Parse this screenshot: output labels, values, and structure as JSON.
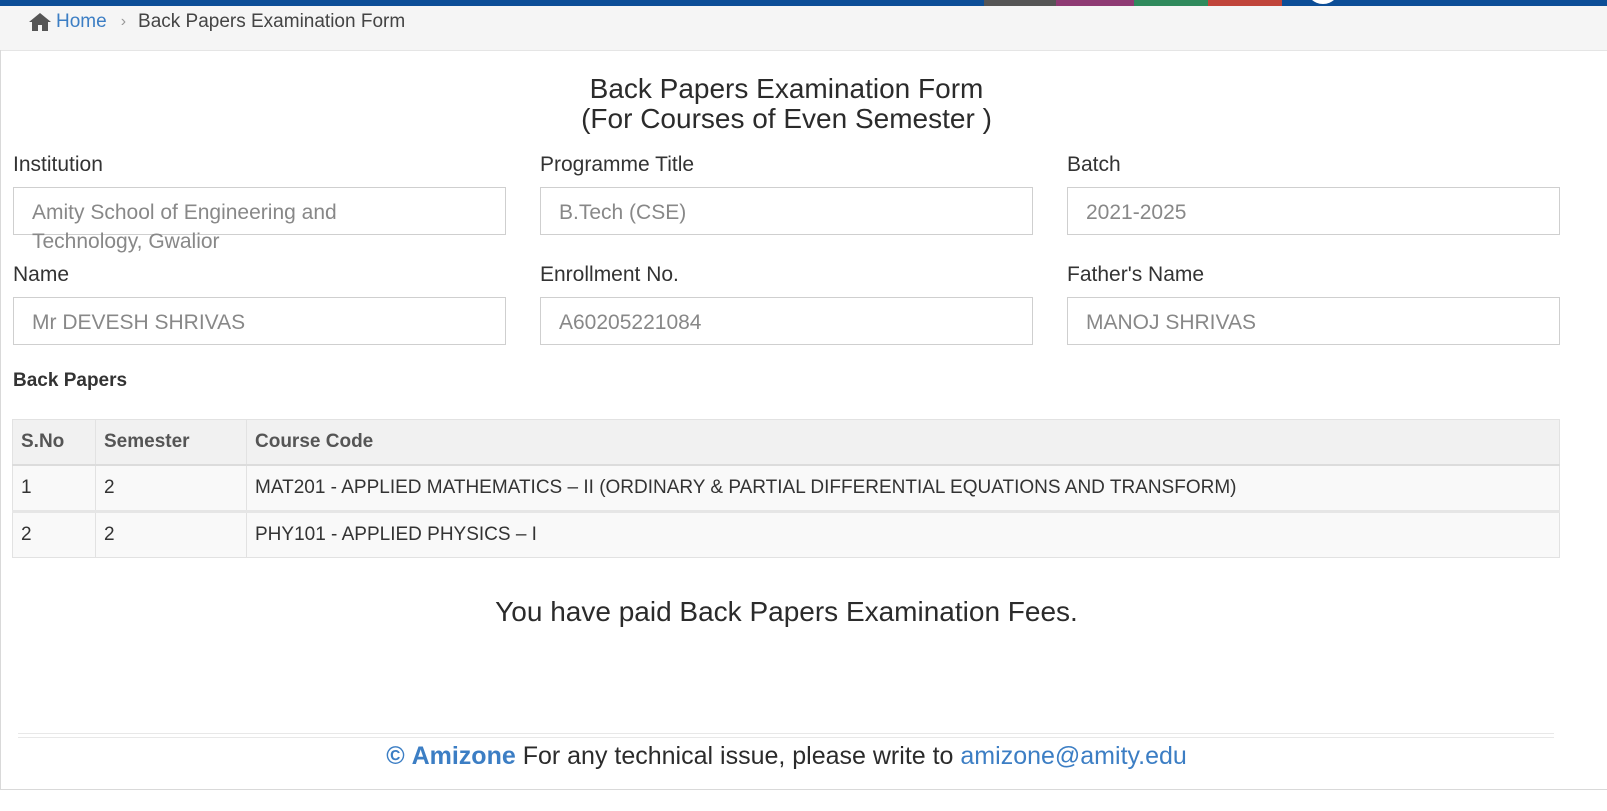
{
  "topbar": {
    "colors": [
      "#0c4e97",
      "#555555",
      "#8e3a73",
      "#2f8a5c",
      "#c0453a",
      "#0c4e97"
    ]
  },
  "breadcrumb": {
    "home_icon": "home-icon",
    "home_label": "Home",
    "separator_icon": "chevron-right-icon",
    "current": "Back Papers Examination Form"
  },
  "form": {
    "title_line1": "Back Papers Examination Form",
    "title_line2": "(For Courses of Even Semester )",
    "fields": {
      "institution": {
        "label": "Institution",
        "value": "Amity School of Engineering and Technology, Gwalior"
      },
      "programme": {
        "label": "Programme Title",
        "value": "B.Tech (CSE)"
      },
      "batch": {
        "label": "Batch",
        "value": "2021-2025"
      },
      "name": {
        "label": "Name",
        "value": "Mr DEVESH SHRIVAS"
      },
      "enrollment": {
        "label": "Enrollment No.",
        "value": "A60205221084"
      },
      "father": {
        "label": "Father's Name",
        "value": "MANOJ SHRIVAS"
      }
    }
  },
  "back_papers": {
    "section_title": "Back Papers",
    "headers": {
      "sno": "S.No",
      "semester": "Semester",
      "course": "Course Code"
    },
    "rows": [
      {
        "sno": "1",
        "semester": "2",
        "course": "MAT201 - APPLIED MATHEMATICS – II (ORDINARY & PARTIAL DIFFERENTIAL EQUATIONS AND TRANSFORM)"
      },
      {
        "sno": "2",
        "semester": "2",
        "course": "PHY101 - APPLIED PHYSICS – I"
      }
    ]
  },
  "status_message": "You have paid Back Papers Examination Fees.",
  "footer": {
    "copyright": "©",
    "brand": "Amizone",
    "text": " For any technical issue, please write to ",
    "email": "amizone@amity.edu"
  },
  "accent_color": "#3c7ec4"
}
